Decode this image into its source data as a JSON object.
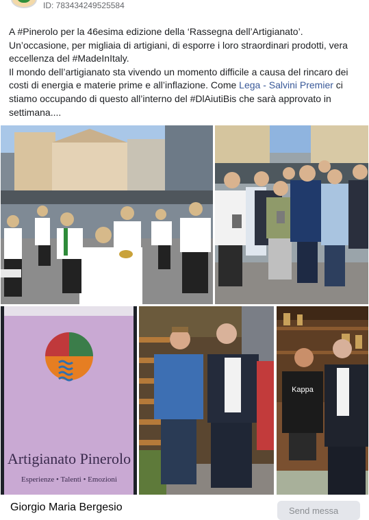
{
  "post": {
    "id_label": "ID: 783434249525584",
    "paragraphs": [
      {
        "segments": [
          {
            "text": "A #Pinerolo per la 46esima edizione della ‘Rassegna dell’Artigianato’. Un’occasione, per migliaia di artigiani, di esporre i loro straordinari prodotti, vera eccellenza del #MadeInItaly.",
            "link": false
          }
        ]
      },
      {
        "segments": [
          {
            "text": "Il mondo dell’artigianato sta vivendo un momento difficile a causa del rincaro dei costi di energia e materie prime e all’inflazione. Come ",
            "link": false
          },
          {
            "text": "Lega - Salvini Premier",
            "link": true
          },
          {
            "text": " ci stiamo occupando di questo all’interno del #DlAiutiBis che sarà approvato in settimana....",
            "link": false
          }
        ]
      }
    ],
    "photos": [
      {
        "name": "photo-marching-band"
      },
      {
        "name": "photo-group"
      },
      {
        "name": "photo-banner",
        "banner_text": "Artigianato Pinerolo",
        "banner_subtext": "Esperienze • Talenti • Emozioni"
      },
      {
        "name": "photo-two-men-shop"
      },
      {
        "name": "photo-two-men-counter",
        "shirt_text": "Kappa"
      }
    ]
  },
  "footer": {
    "author_name": "Giorgio Maria Bergesio",
    "send_button_label": "Send messa"
  }
}
